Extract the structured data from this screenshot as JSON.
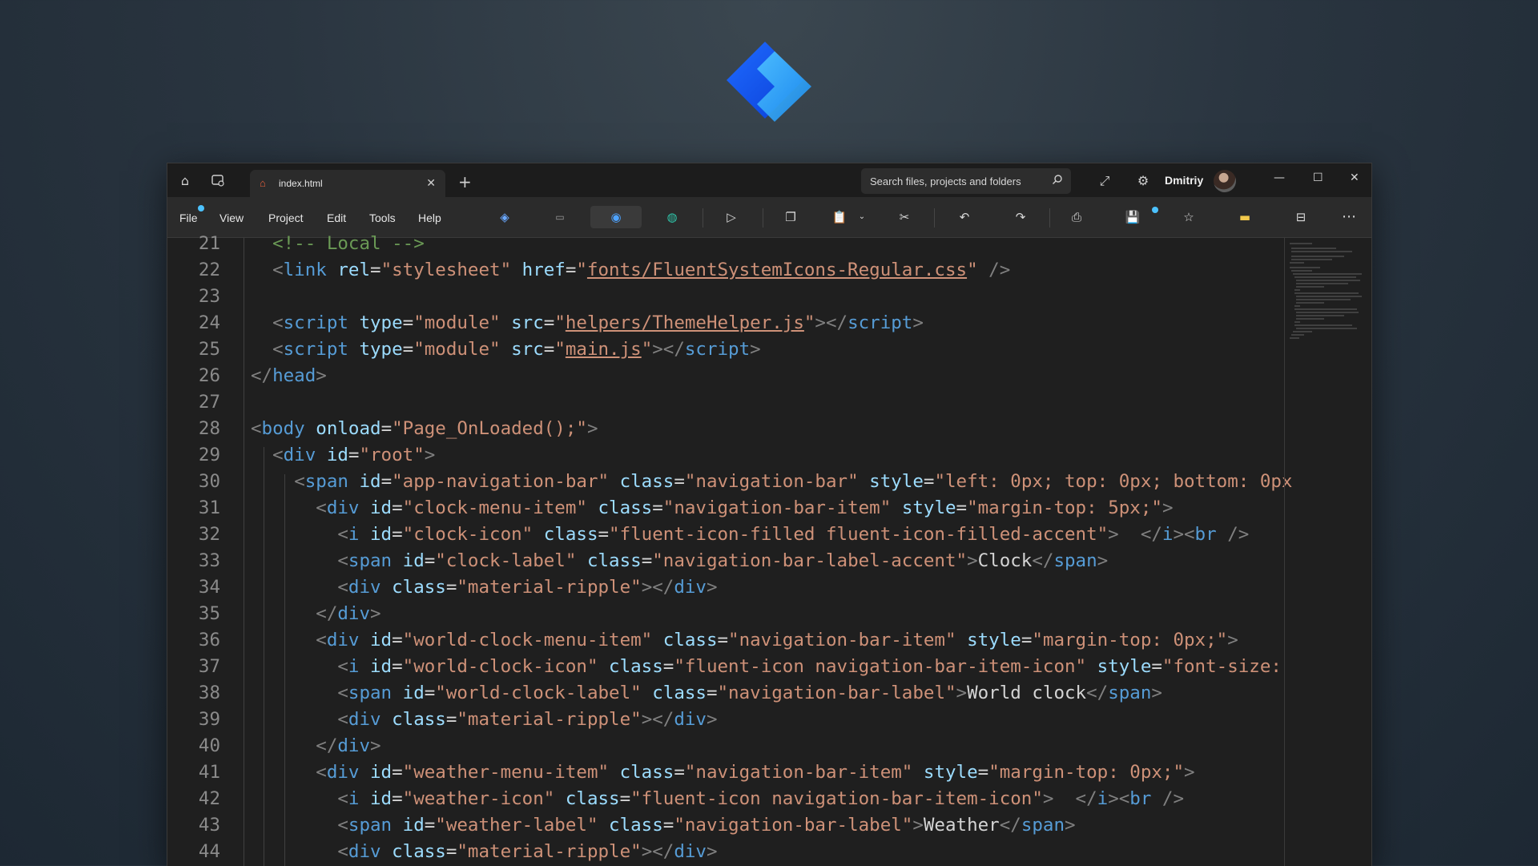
{
  "window": {
    "tab_title": "index.html",
    "search_placeholder": "Search files, projects and folders",
    "user_name": "Dmitriy"
  },
  "menu": [
    "File",
    "View",
    "Project",
    "Edit",
    "Tools",
    "Help"
  ],
  "colors": {
    "accent": "#4cc2ff",
    "editor_bg": "#1f1f1f",
    "tag": "#569cd6",
    "attribute": "#9cdcfe",
    "string": "#ce9178",
    "comment": "#6a9955"
  },
  "code_lines": [
    {
      "n": "21",
      "indent": 1,
      "t": [
        [
          "com",
          "<!-- Local -->"
        ]
      ]
    },
    {
      "n": "22",
      "indent": 1,
      "t": [
        [
          "br",
          "<"
        ],
        [
          "tag",
          "link"
        ],
        [
          "txt",
          " "
        ],
        [
          "attr",
          "rel"
        ],
        [
          "eq",
          "="
        ],
        [
          "str",
          "\"stylesheet\""
        ],
        [
          "txt",
          " "
        ],
        [
          "attr",
          "href"
        ],
        [
          "eq",
          "="
        ],
        [
          "str",
          "\""
        ],
        [
          "link",
          "fonts/FluentSystemIcons-Regular.css"
        ],
        [
          "str",
          "\""
        ],
        [
          "txt",
          " "
        ],
        [
          "br",
          "/>"
        ]
      ]
    },
    {
      "n": "23",
      "indent": 0,
      "t": []
    },
    {
      "n": "24",
      "indent": 1,
      "t": [
        [
          "br",
          "<"
        ],
        [
          "tag",
          "script"
        ],
        [
          "txt",
          " "
        ],
        [
          "attr",
          "type"
        ],
        [
          "eq",
          "="
        ],
        [
          "str",
          "\"module\""
        ],
        [
          "txt",
          " "
        ],
        [
          "attr",
          "src"
        ],
        [
          "eq",
          "="
        ],
        [
          "str",
          "\""
        ],
        [
          "link",
          "helpers/ThemeHelper.js"
        ],
        [
          "str",
          "\""
        ],
        [
          "br",
          "></"
        ],
        [
          "tag",
          "script"
        ],
        [
          "br",
          ">"
        ]
      ]
    },
    {
      "n": "25",
      "indent": 1,
      "t": [
        [
          "br",
          "<"
        ],
        [
          "tag",
          "script"
        ],
        [
          "txt",
          " "
        ],
        [
          "attr",
          "type"
        ],
        [
          "eq",
          "="
        ],
        [
          "str",
          "\"module\""
        ],
        [
          "txt",
          " "
        ],
        [
          "attr",
          "src"
        ],
        [
          "eq",
          "="
        ],
        [
          "str",
          "\""
        ],
        [
          "link",
          "main.js"
        ],
        [
          "str",
          "\""
        ],
        [
          "br",
          "></"
        ],
        [
          "tag",
          "script"
        ],
        [
          "br",
          ">"
        ]
      ]
    },
    {
      "n": "26",
      "indent": 0,
      "t": [
        [
          "br",
          "</"
        ],
        [
          "tag",
          "head"
        ],
        [
          "br",
          ">"
        ]
      ]
    },
    {
      "n": "27",
      "indent": 0,
      "t": []
    },
    {
      "n": "28",
      "indent": 0,
      "t": [
        [
          "br",
          "<"
        ],
        [
          "tag",
          "body"
        ],
        [
          "txt",
          " "
        ],
        [
          "attr",
          "onload"
        ],
        [
          "eq",
          "="
        ],
        [
          "str",
          "\"Page_OnLoaded();\""
        ],
        [
          "br",
          ">"
        ]
      ]
    },
    {
      "n": "29",
      "indent": 1,
      "t": [
        [
          "br",
          "<"
        ],
        [
          "tag",
          "div"
        ],
        [
          "txt",
          " "
        ],
        [
          "attr",
          "id"
        ],
        [
          "eq",
          "="
        ],
        [
          "str",
          "\"root\""
        ],
        [
          "br",
          ">"
        ]
      ]
    },
    {
      "n": "30",
      "indent": 2,
      "t": [
        [
          "br",
          "<"
        ],
        [
          "tag",
          "span"
        ],
        [
          "txt",
          " "
        ],
        [
          "attr",
          "id"
        ],
        [
          "eq",
          "="
        ],
        [
          "str",
          "\"app-navigation-bar\""
        ],
        [
          "txt",
          " "
        ],
        [
          "attr",
          "class"
        ],
        [
          "eq",
          "="
        ],
        [
          "str",
          "\"navigation-bar\""
        ],
        [
          "txt",
          " "
        ],
        [
          "attr",
          "style"
        ],
        [
          "eq",
          "="
        ],
        [
          "str",
          "\"left: 0px; top: 0px; bottom: 0px"
        ]
      ]
    },
    {
      "n": "31",
      "indent": 3,
      "t": [
        [
          "br",
          "<"
        ],
        [
          "tag",
          "div"
        ],
        [
          "txt",
          " "
        ],
        [
          "attr",
          "id"
        ],
        [
          "eq",
          "="
        ],
        [
          "str",
          "\"clock-menu-item\""
        ],
        [
          "txt",
          " "
        ],
        [
          "attr",
          "class"
        ],
        [
          "eq",
          "="
        ],
        [
          "str",
          "\"navigation-bar-item\""
        ],
        [
          "txt",
          " "
        ],
        [
          "attr",
          "style"
        ],
        [
          "eq",
          "="
        ],
        [
          "str",
          "\"margin-top: 5px;\""
        ],
        [
          "br",
          ">"
        ]
      ]
    },
    {
      "n": "32",
      "indent": 4,
      "t": [
        [
          "br",
          "<"
        ],
        [
          "tag",
          "i"
        ],
        [
          "txt",
          " "
        ],
        [
          "attr",
          "id"
        ],
        [
          "eq",
          "="
        ],
        [
          "str",
          "\"clock-icon\""
        ],
        [
          "txt",
          " "
        ],
        [
          "attr",
          "class"
        ],
        [
          "eq",
          "="
        ],
        [
          "str",
          "\"fluent-icon-filled fluent-icon-filled-accent\""
        ],
        [
          "br",
          ">"
        ],
        [
          "txt",
          "  "
        ],
        [
          "br",
          "</"
        ],
        [
          "tag",
          "i"
        ],
        [
          "br",
          "><"
        ],
        [
          "tag",
          "br"
        ],
        [
          "txt",
          " "
        ],
        [
          "br",
          "/>"
        ]
      ]
    },
    {
      "n": "33",
      "indent": 4,
      "t": [
        [
          "br",
          "<"
        ],
        [
          "tag",
          "span"
        ],
        [
          "txt",
          " "
        ],
        [
          "attr",
          "id"
        ],
        [
          "eq",
          "="
        ],
        [
          "str",
          "\"clock-label\""
        ],
        [
          "txt",
          " "
        ],
        [
          "attr",
          "class"
        ],
        [
          "eq",
          "="
        ],
        [
          "str",
          "\"navigation-bar-label-accent\""
        ],
        [
          "br",
          ">"
        ],
        [
          "txt",
          "Clock"
        ],
        [
          "br",
          "</"
        ],
        [
          "tag",
          "span"
        ],
        [
          "br",
          ">"
        ]
      ]
    },
    {
      "n": "34",
      "indent": 4,
      "t": [
        [
          "br",
          "<"
        ],
        [
          "tag",
          "div"
        ],
        [
          "txt",
          " "
        ],
        [
          "attr",
          "class"
        ],
        [
          "eq",
          "="
        ],
        [
          "str",
          "\"material-ripple\""
        ],
        [
          "br",
          "></"
        ],
        [
          "tag",
          "div"
        ],
        [
          "br",
          ">"
        ]
      ]
    },
    {
      "n": "35",
      "indent": 3,
      "t": [
        [
          "br",
          "</"
        ],
        [
          "tag",
          "div"
        ],
        [
          "br",
          ">"
        ]
      ]
    },
    {
      "n": "36",
      "indent": 3,
      "t": [
        [
          "br",
          "<"
        ],
        [
          "tag",
          "div"
        ],
        [
          "txt",
          " "
        ],
        [
          "attr",
          "id"
        ],
        [
          "eq",
          "="
        ],
        [
          "str",
          "\"world-clock-menu-item\""
        ],
        [
          "txt",
          " "
        ],
        [
          "attr",
          "class"
        ],
        [
          "eq",
          "="
        ],
        [
          "str",
          "\"navigation-bar-item\""
        ],
        [
          "txt",
          " "
        ],
        [
          "attr",
          "style"
        ],
        [
          "eq",
          "="
        ],
        [
          "str",
          "\"margin-top: 0px;\""
        ],
        [
          "br",
          ">"
        ]
      ]
    },
    {
      "n": "37",
      "indent": 4,
      "t": [
        [
          "br",
          "<"
        ],
        [
          "tag",
          "i"
        ],
        [
          "txt",
          " "
        ],
        [
          "attr",
          "id"
        ],
        [
          "eq",
          "="
        ],
        [
          "str",
          "\"world-clock-icon\""
        ],
        [
          "txt",
          " "
        ],
        [
          "attr",
          "class"
        ],
        [
          "eq",
          "="
        ],
        [
          "str",
          "\"fluent-icon navigation-bar-item-icon\""
        ],
        [
          "txt",
          " "
        ],
        [
          "attr",
          "style"
        ],
        [
          "eq",
          "="
        ],
        [
          "str",
          "\"font-size:"
        ]
      ]
    },
    {
      "n": "38",
      "indent": 4,
      "t": [
        [
          "br",
          "<"
        ],
        [
          "tag",
          "span"
        ],
        [
          "txt",
          " "
        ],
        [
          "attr",
          "id"
        ],
        [
          "eq",
          "="
        ],
        [
          "str",
          "\"world-clock-label\""
        ],
        [
          "txt",
          " "
        ],
        [
          "attr",
          "class"
        ],
        [
          "eq",
          "="
        ],
        [
          "str",
          "\"navigation-bar-label\""
        ],
        [
          "br",
          ">"
        ],
        [
          "txt",
          "World clock"
        ],
        [
          "br",
          "</"
        ],
        [
          "tag",
          "span"
        ],
        [
          "br",
          ">"
        ]
      ]
    },
    {
      "n": "39",
      "indent": 4,
      "t": [
        [
          "br",
          "<"
        ],
        [
          "tag",
          "div"
        ],
        [
          "txt",
          " "
        ],
        [
          "attr",
          "class"
        ],
        [
          "eq",
          "="
        ],
        [
          "str",
          "\"material-ripple\""
        ],
        [
          "br",
          "></"
        ],
        [
          "tag",
          "div"
        ],
        [
          "br",
          ">"
        ]
      ]
    },
    {
      "n": "40",
      "indent": 3,
      "t": [
        [
          "br",
          "</"
        ],
        [
          "tag",
          "div"
        ],
        [
          "br",
          ">"
        ]
      ]
    },
    {
      "n": "41",
      "indent": 3,
      "t": [
        [
          "br",
          "<"
        ],
        [
          "tag",
          "div"
        ],
        [
          "txt",
          " "
        ],
        [
          "attr",
          "id"
        ],
        [
          "eq",
          "="
        ],
        [
          "str",
          "\"weather-menu-item\""
        ],
        [
          "txt",
          " "
        ],
        [
          "attr",
          "class"
        ],
        [
          "eq",
          "="
        ],
        [
          "str",
          "\"navigation-bar-item\""
        ],
        [
          "txt",
          " "
        ],
        [
          "attr",
          "style"
        ],
        [
          "eq",
          "="
        ],
        [
          "str",
          "\"margin-top: 0px;\""
        ],
        [
          "br",
          ">"
        ]
      ]
    },
    {
      "n": "42",
      "indent": 4,
      "t": [
        [
          "br",
          "<"
        ],
        [
          "tag",
          "i"
        ],
        [
          "txt",
          " "
        ],
        [
          "attr",
          "id"
        ],
        [
          "eq",
          "="
        ],
        [
          "str",
          "\"weather-icon\""
        ],
        [
          "txt",
          " "
        ],
        [
          "attr",
          "class"
        ],
        [
          "eq",
          "="
        ],
        [
          "str",
          "\"fluent-icon navigation-bar-item-icon\""
        ],
        [
          "br",
          ">"
        ],
        [
          "txt",
          "  "
        ],
        [
          "br",
          "</"
        ],
        [
          "tag",
          "i"
        ],
        [
          "br",
          "><"
        ],
        [
          "tag",
          "br"
        ],
        [
          "txt",
          " "
        ],
        [
          "br",
          "/>"
        ]
      ]
    },
    {
      "n": "43",
      "indent": 4,
      "t": [
        [
          "br",
          "<"
        ],
        [
          "tag",
          "span"
        ],
        [
          "txt",
          " "
        ],
        [
          "attr",
          "id"
        ],
        [
          "eq",
          "="
        ],
        [
          "str",
          "\"weather-label\""
        ],
        [
          "txt",
          " "
        ],
        [
          "attr",
          "class"
        ],
        [
          "eq",
          "="
        ],
        [
          "str",
          "\"navigation-bar-label\""
        ],
        [
          "br",
          ">"
        ],
        [
          "txt",
          "Weather"
        ],
        [
          "br",
          "</"
        ],
        [
          "tag",
          "span"
        ],
        [
          "br",
          ">"
        ]
      ]
    },
    {
      "n": "44",
      "indent": 4,
      "t": [
        [
          "br",
          "<"
        ],
        [
          "tag",
          "div"
        ],
        [
          "txt",
          " "
        ],
        [
          "attr",
          "class"
        ],
        [
          "eq",
          "="
        ],
        [
          "str",
          "\"material-ripple\""
        ],
        [
          "br",
          "></"
        ],
        [
          "tag",
          "div"
        ],
        [
          "br",
          ">"
        ]
      ]
    }
  ]
}
